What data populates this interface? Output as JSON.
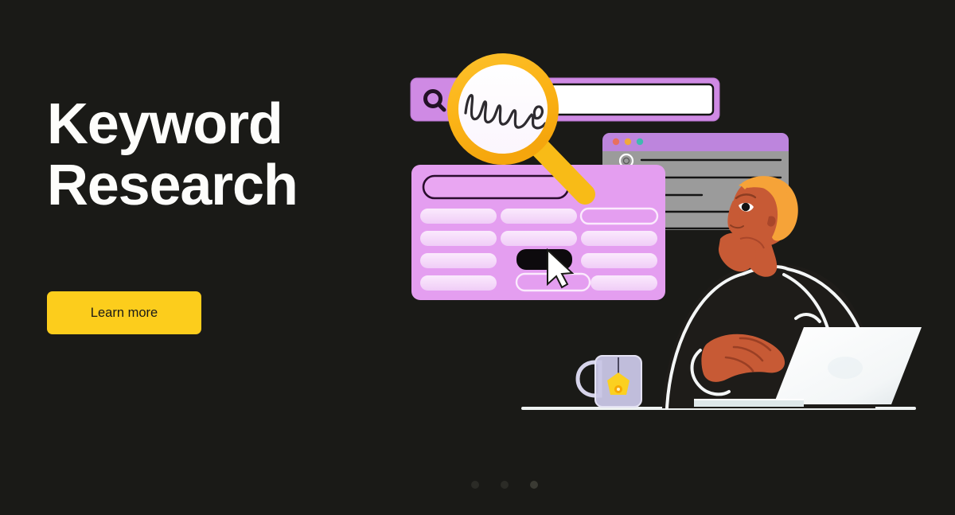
{
  "page": {
    "background_color": "#1a1a17",
    "title_line1": "Keyword",
    "title_line2": "Research",
    "title_full": "Keyword\nResearch"
  },
  "cta": {
    "label": "Learn more",
    "background_color": "#fccd1c",
    "text_color": "#1a1a17"
  },
  "illustration": {
    "name": "keyword-research-illustration",
    "search_bar": {
      "name": "search-bar",
      "bar_color": "#cf8ae4",
      "input_value": "",
      "input_placeholder": "",
      "icon": "magnifier-circle-icon"
    },
    "magnifier": {
      "name": "magnifying-glass",
      "ring_color": "#fbb316",
      "lens_scribble": "handwritten-scribble"
    },
    "keyword_panel": {
      "name": "keyword-results-panel",
      "panel_color": "#e49ef0",
      "search_field_label": "",
      "selected_pill_color": "#0d0a0d",
      "rows": 4,
      "columns": 3,
      "cursor": "mouse-pointer-cursor"
    },
    "browser_window": {
      "name": "browser-window",
      "titlebar_color": "#bd85dd",
      "content_color": "#9b9b9b",
      "dots": [
        "#e8705f",
        "#f0a93c",
        "#41b8b0"
      ]
    },
    "person": {
      "name": "person-at-laptop",
      "hair_color": "#f6a338",
      "skin_color": "#c75a35",
      "shirt_color": "#1e1c19"
    },
    "laptop": {
      "name": "laptop",
      "color": "#f4f6f6"
    },
    "mug": {
      "name": "coffee-mug",
      "color": "#c9c6e6",
      "tag_color": "#fbd020"
    },
    "desk": {
      "name": "desk-line",
      "color": "#eef2f2"
    }
  },
  "pagination": {
    "name": "carousel-pagination",
    "dots": [
      {
        "label": "1",
        "active": false
      },
      {
        "label": "2",
        "active": false
      },
      {
        "label": "3",
        "active": true
      }
    ]
  }
}
